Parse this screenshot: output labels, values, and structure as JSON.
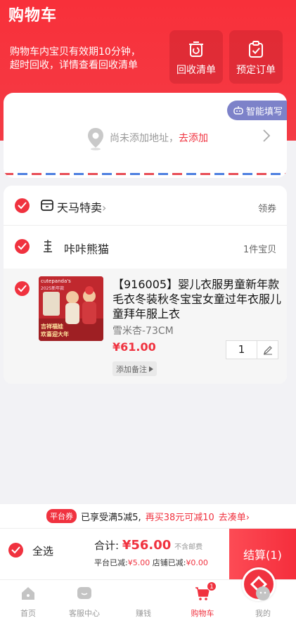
{
  "header": {
    "title": "购物车",
    "notice_line1": "购物车内宝贝有效期10分钟，",
    "notice_line2": "超时回收，详情查看回收清单",
    "recycle_label": "回收清单",
    "preorder_label": "预定订单"
  },
  "address": {
    "smart_fill_label": "智能填写",
    "empty_text": "尚未添加地址，",
    "add_link": "去添加"
  },
  "shop": {
    "tmall_label": "天马特卖",
    "tmall_chevron": "›",
    "coupon_label": "领券",
    "store_name": "咔咔熊猫",
    "store_count": "1件宝贝"
  },
  "item": {
    "title": "【916005】婴儿衣服男童新年款毛衣冬装秋冬宝宝女童过年衣服儿童拜年服上衣",
    "sku": "雪米杏-73CM",
    "price": "¥61.00",
    "quantity": "1",
    "note_label": "添加备注",
    "thumb_brand": "cutepanda's",
    "thumb_sub": "2025新年款",
    "thumb_slogan1": "吉祥福娃",
    "thumb_slogan2": "欢喜迎大年"
  },
  "promo": {
    "tag": "平台券",
    "text": "已享受满5减5,",
    "highlight": "再买38元可减10",
    "link": "去凑单",
    "link_chevron": "›"
  },
  "checkout": {
    "select_all": "全选",
    "total_label": "合计:",
    "total_amount": "¥56.00",
    "no_postage": "不含邮费",
    "platform_discount_label": "平台已减:",
    "platform_discount": "¥5.00",
    "store_discount_label": "店铺已减:",
    "store_discount": "¥0.00",
    "pay_label": "结算(1)"
  },
  "tabbar": {
    "home": "首页",
    "service": "客服中心",
    "earn": "赚钱",
    "cart": "购物车",
    "cart_badge": "1",
    "mine": "我的"
  },
  "colors": {
    "brand_red": "#f0323f",
    "smart_fill": "#7d82c9"
  }
}
